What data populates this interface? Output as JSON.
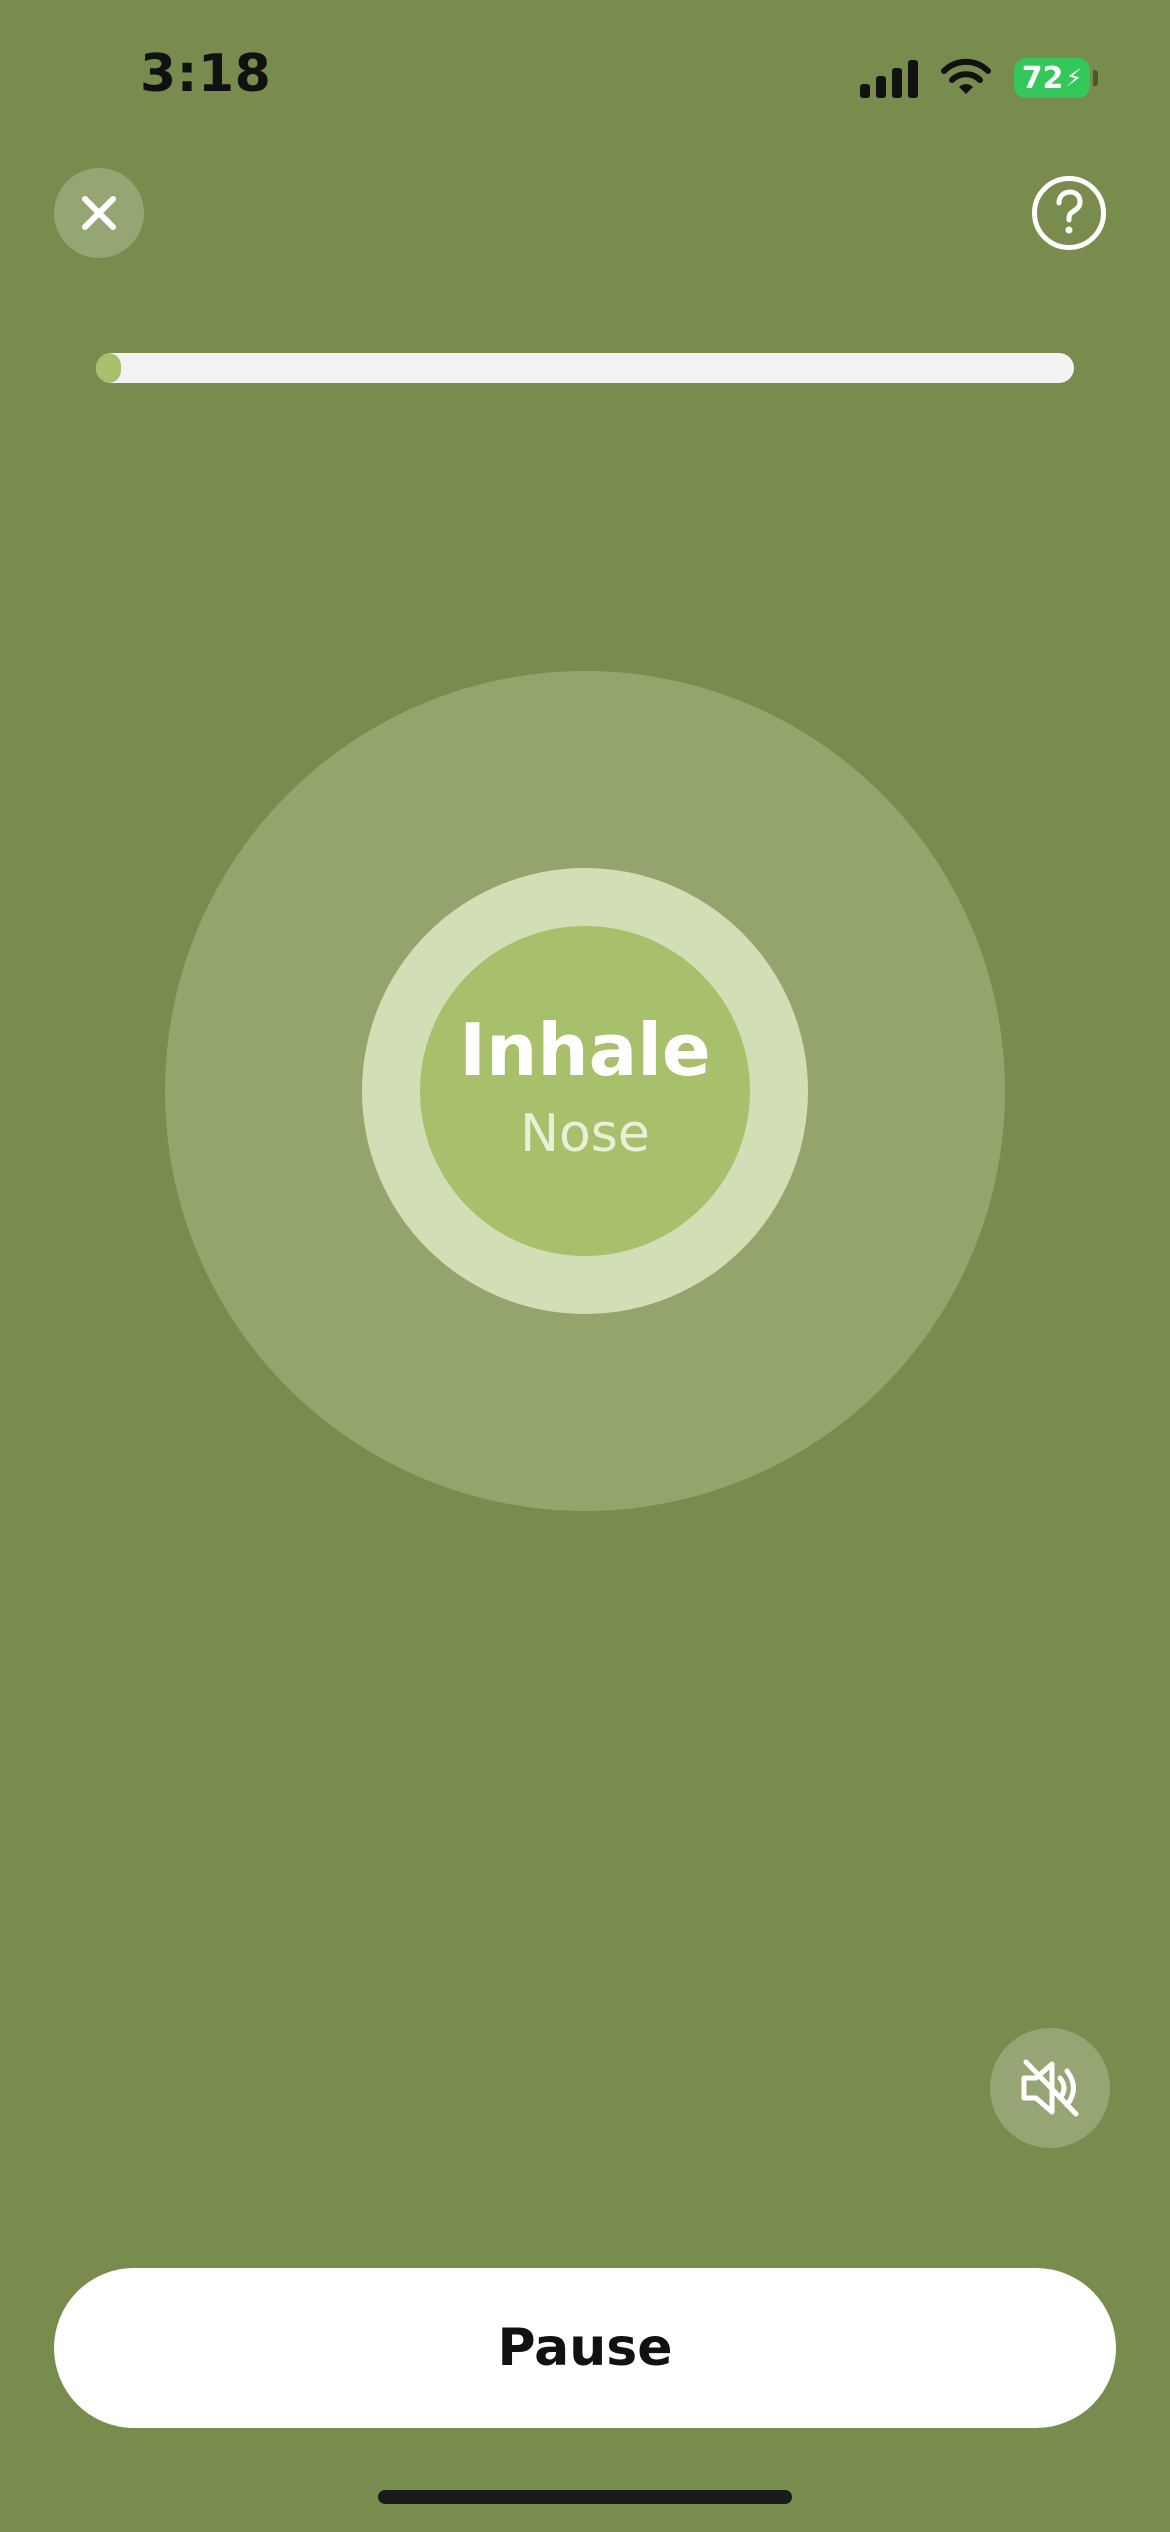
{
  "status_bar": {
    "time": "3:18",
    "battery_level": "72",
    "battery_charging": true
  },
  "header": {
    "close_icon": "close-icon",
    "help_icon": "help-question-icon"
  },
  "progress": {
    "fraction": 0.026,
    "colors": {
      "track": "#f3f3f3",
      "fill": "#a8c06c"
    }
  },
  "breathing": {
    "phase": "Inhale",
    "instruction": "Nose"
  },
  "controls": {
    "mute_icon": "speaker-muted-icon",
    "pause_label": "Pause"
  },
  "theme": {
    "background": "#788c4e",
    "outer_circle": "#93a56c",
    "middle_ring": "#d2dfb6",
    "inner_circle": "#a8c06c"
  }
}
